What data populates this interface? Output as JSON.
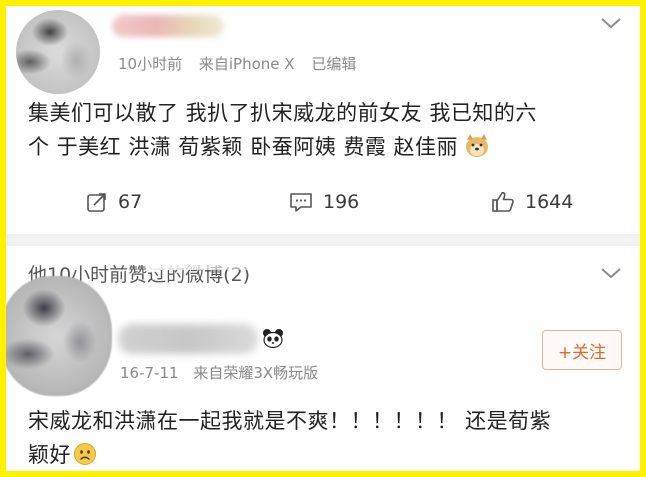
{
  "post1": {
    "time": "10小时前",
    "source": "来自iPhone X",
    "edited": "已编辑",
    "text_line1": "集美们可以散了 我扒了扒宋威龙的前女友 我已知的六",
    "text_line2": "个 于美红 洪潇 荀紫颖 卧蚕阿姨 费霞 赵佳丽",
    "emoji": "doge",
    "actions": {
      "repost_count": "67",
      "comment_count": "196",
      "like_count": "1644"
    }
  },
  "liked_header": {
    "text": "他10小时前赞过的微博(2)"
  },
  "post2": {
    "date": "16-7-11",
    "source": "来自荣耀3X畅玩版",
    "follow_label": "+关注",
    "text_line1": "宋威龙和洪潇在一起我就是不爽！！！！！！ 还是荀紫",
    "text_line2": "颖好",
    "emoji": "sad-face"
  },
  "colors": {
    "frame": "#fff200",
    "accent": "#e06a2a",
    "separator": "#f2f2f2"
  }
}
